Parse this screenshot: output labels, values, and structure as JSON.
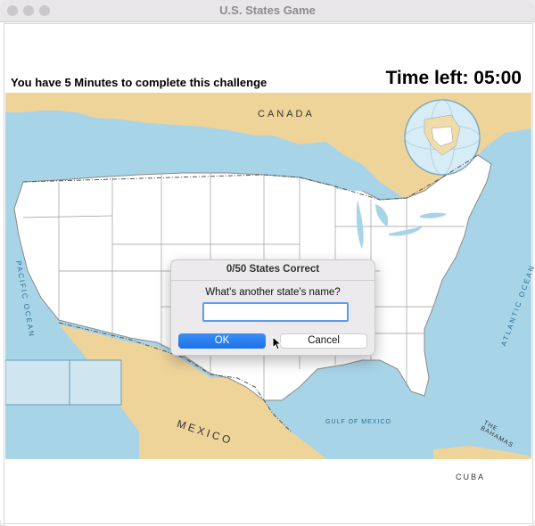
{
  "window": {
    "title": "U.S. States Game"
  },
  "header": {
    "subtitle": "You have 5 Minutes to complete this challenge",
    "timer": "Time left: 05:00"
  },
  "map_labels": {
    "canada": "CANADA",
    "mexico": "MEXICO",
    "pacific_ocean": "PACIFIC OCEAN",
    "atlantic_ocean": "ATLANTIC OCEAN",
    "gulf_of_mexico": "GULF OF MEXICO",
    "the_bahamas": "THE BAHAMAS",
    "cuba": "CUBA"
  },
  "dialog": {
    "title": "0/50 States Correct",
    "prompt": "What's another state's name?",
    "input_value": "",
    "ok_label": "OK",
    "cancel_label": "Cancel"
  },
  "colors": {
    "ocean": "#a8d4e8",
    "foreign_land": "#efd49a",
    "us_land": "#ffffff",
    "primary_button": "#1f74e8"
  }
}
